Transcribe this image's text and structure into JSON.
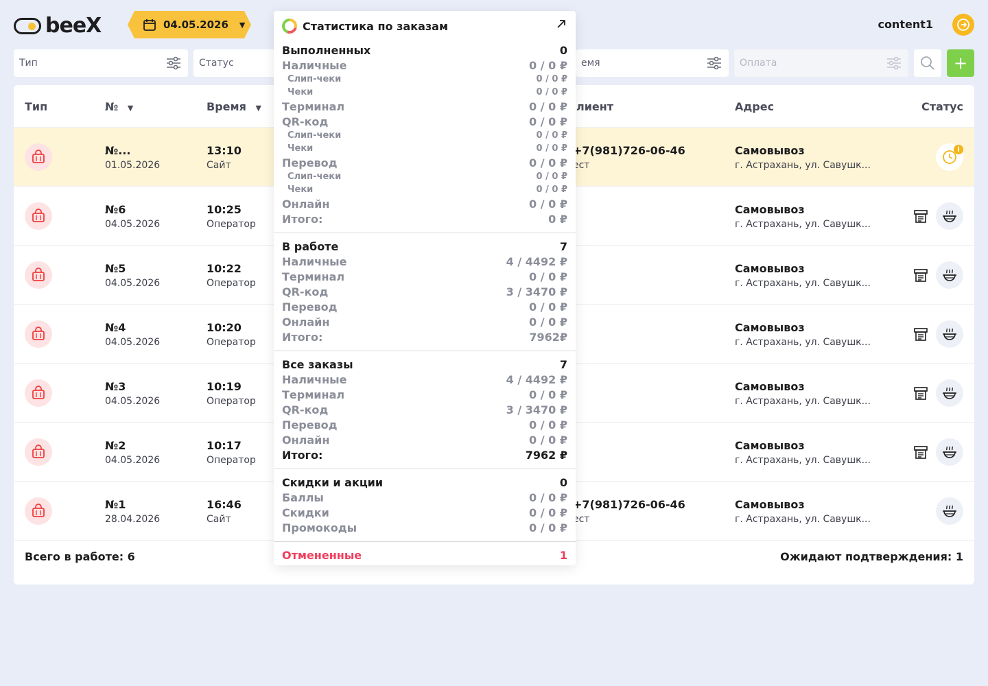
{
  "header": {
    "logo_text": "beeX",
    "date": "04.05.2026",
    "user": "content1"
  },
  "filters": {
    "type": "Тип",
    "status": "Статус",
    "time_partial": "емя",
    "payment": "Оплата"
  },
  "table": {
    "columns": {
      "type": "Тип",
      "num": "№",
      "time": "Время",
      "client_partial": "лиент",
      "address": "Адрес",
      "status": "Статус"
    },
    "rows": [
      {
        "num": "№...",
        "date": "01.05.2026",
        "time": "13:10",
        "source": "Сайт",
        "phone": "+7(981)726-06-46",
        "client_sub": "ест",
        "addr_title": "Самовывоз",
        "addr": "г. Астрахань, ул. Савушк...",
        "status": "pending"
      },
      {
        "num": "№6",
        "date": "04.05.2026",
        "time": "10:25",
        "source": "Оператор",
        "phone": "",
        "client_sub": "",
        "addr_title": "Самовывоз",
        "addr": "г. Астрахань, ул. Савушк...",
        "status": "cooking"
      },
      {
        "num": "№5",
        "date": "04.05.2026",
        "time": "10:22",
        "source": "Оператор",
        "phone": "",
        "client_sub": "",
        "addr_title": "Самовывоз",
        "addr": "г. Астрахань, ул. Савушк...",
        "status": "cooking"
      },
      {
        "num": "№4",
        "date": "04.05.2026",
        "time": "10:20",
        "source": "Оператор",
        "phone": "",
        "client_sub": "",
        "addr_title": "Самовывоз",
        "addr": "г. Астрахань, ул. Савушк...",
        "status": "cooking"
      },
      {
        "num": "№3",
        "date": "04.05.2026",
        "time": "10:19",
        "source": "Оператор",
        "phone": "",
        "client_sub": "",
        "addr_title": "Самовывоз",
        "addr": "г. Астрахань, ул. Савушк...",
        "status": "cooking"
      },
      {
        "num": "№2",
        "date": "04.05.2026",
        "time": "10:17",
        "source": "Оператор",
        "phone": "",
        "client_sub": "",
        "addr_title": "Самовывоз",
        "addr": "г. Астрахань, ул. Савушк...",
        "status": "cooking"
      },
      {
        "num": "№1",
        "date": "28.04.2026",
        "time": "16:46",
        "source": "Сайт",
        "phone": "+7(981)726-06-46",
        "client_sub": "ест",
        "addr_title": "Самовывоз",
        "addr": "г. Астрахань, ул. Савушк...",
        "status": "cooking-only"
      }
    ],
    "footer_left": "Всего в работе: 6",
    "footer_right": "Ожидают подтверждения: 1"
  },
  "popup": {
    "title": "Статистика по заказам",
    "completed": {
      "label": "Выполненных",
      "count": "0",
      "lines": [
        {
          "label": "Наличные",
          "value": "0 / 0 ₽",
          "sub": false
        },
        {
          "label": "Слип-чеки",
          "value": "0 / 0 ₽",
          "sub": true
        },
        {
          "label": "Чеки",
          "value": "0 / 0 ₽",
          "sub": true
        },
        {
          "label": "Терминал",
          "value": "0 / 0 ₽",
          "sub": false
        },
        {
          "label": "QR-код",
          "value": "0 / 0 ₽",
          "sub": false
        },
        {
          "label": "Слип-чеки",
          "value": "0 / 0 ₽",
          "sub": true
        },
        {
          "label": "Чеки",
          "value": "0 / 0 ₽",
          "sub": true
        },
        {
          "label": "Перевод",
          "value": "0 / 0 ₽",
          "sub": false
        },
        {
          "label": "Слип-чеки",
          "value": "0 / 0 ₽",
          "sub": true
        },
        {
          "label": "Чеки",
          "value": "0 / 0 ₽",
          "sub": true
        },
        {
          "label": "Онлайн",
          "value": "0 / 0 ₽",
          "sub": false
        },
        {
          "label": "Итого:",
          "value": "0 ₽",
          "sub": false
        }
      ]
    },
    "in_work": {
      "label": "В работе",
      "count": "7",
      "lines": [
        {
          "label": "Наличные",
          "value": "4 / 4492 ₽"
        },
        {
          "label": "Терминал",
          "value": "0 / 0 ₽"
        },
        {
          "label": "QR-код",
          "value": "3 / 3470 ₽"
        },
        {
          "label": "Перевод",
          "value": "0 / 0 ₽"
        },
        {
          "label": "Онлайн",
          "value": "0 / 0 ₽"
        },
        {
          "label": "Итого:",
          "value": "7962₽"
        }
      ]
    },
    "all_orders": {
      "label": "Все заказы",
      "count": "7",
      "lines": [
        {
          "label": "Наличные",
          "value": "4 / 4492 ₽"
        },
        {
          "label": "Терминал",
          "value": "0 / 0 ₽"
        },
        {
          "label": "QR-код",
          "value": "3 / 3470 ₽"
        },
        {
          "label": "Перевод",
          "value": "0 / 0 ₽"
        },
        {
          "label": "Онлайн",
          "value": "0 / 0 ₽"
        }
      ],
      "total_label": "Итого:",
      "total_value": "7962 ₽"
    },
    "discounts": {
      "label": "Скидки и акции",
      "count": "0",
      "lines": [
        {
          "label": "Баллы",
          "value": "0 / 0 ₽"
        },
        {
          "label": "Скидки",
          "value": "0 / 0 ₽"
        },
        {
          "label": "Промокоды",
          "value": "0 / 0 ₽"
        }
      ]
    },
    "cancelled": {
      "label": "Отмененные",
      "count": "1"
    }
  },
  "colors": {
    "accent": "#f9c23c",
    "add": "#7ed04a",
    "cancel": "#ef3e5c",
    "highlight": "#fef4d6"
  }
}
